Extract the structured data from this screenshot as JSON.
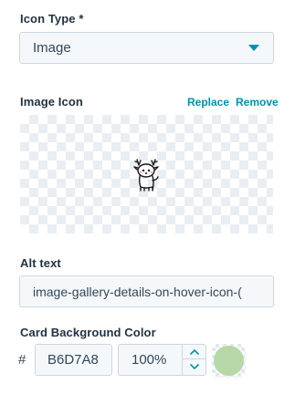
{
  "icon_type": {
    "label": "Icon Type *",
    "value": "Image"
  },
  "image_icon": {
    "label": "Image Icon",
    "replace_label": "Replace",
    "remove_label": "Remove",
    "image": "deer-icon"
  },
  "alt_text": {
    "label": "Alt text",
    "value": "image-gallery-details-on-hover-icon-("
  },
  "card_background": {
    "label": "Card Background Color",
    "hash": "#",
    "hex": "B6D7A8",
    "opacity": "100%",
    "swatch_color": "#B6D7A8"
  },
  "colors": {
    "link": "#0091ae",
    "input_bg": "#f5f8fa",
    "border": "#cbd6e2"
  }
}
